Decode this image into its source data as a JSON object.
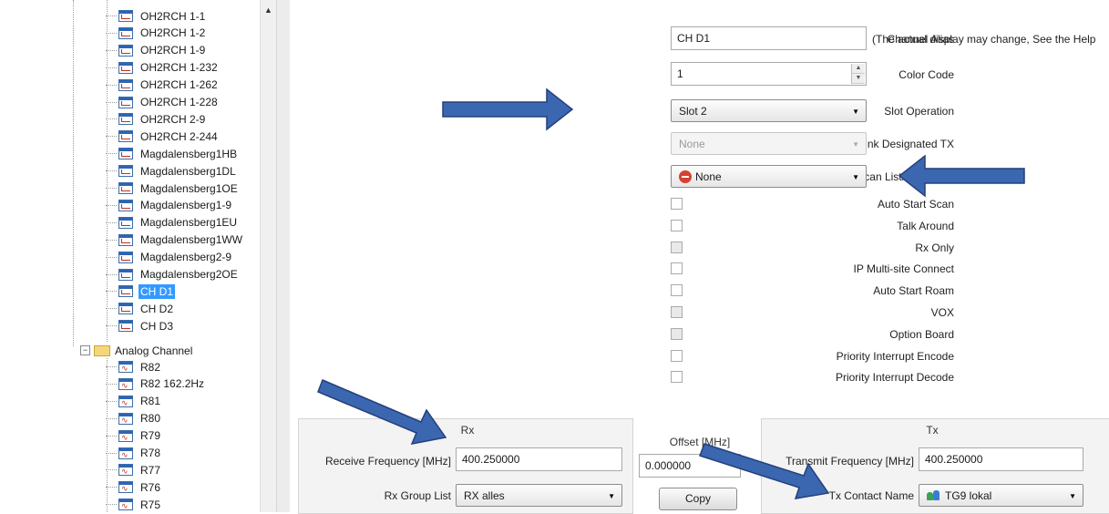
{
  "tree": {
    "digital_channels": [
      "OH2RCH 1-1",
      "OH2RCH 1-2",
      "OH2RCH 1-9",
      "OH2RCH 1-232",
      "OH2RCH 1-262",
      "OH2RCH 1-228",
      "OH2RCH 2-9",
      "OH2RCH 2-244",
      "Magdalensberg1HB",
      "Magdalensberg1DL",
      "Magdalensberg1OE",
      "Magdalensberg1-9",
      "Magdalensberg1EU",
      "Magdalensberg1WW",
      "Magdalensberg2-9",
      "Magdalensberg2OE",
      "CH D1",
      "CH D2",
      "CH D3"
    ],
    "selected": "CH D1",
    "folder_label": "Analog Channel",
    "analog_channels": [
      "R82",
      "R82 162.2Hz",
      "R81",
      "R80",
      "R79",
      "R78",
      "R77",
      "R76",
      "R75"
    ]
  },
  "form": {
    "channel_alias": {
      "label": "Channel Alias",
      "value": "CH D1",
      "note": "(The actual display may change, See the Help"
    },
    "color_code": {
      "label": "Color Code",
      "value": "1"
    },
    "slot_operation": {
      "label": "Slot Operation",
      "value": "Slot 2"
    },
    "pseudo_trunk": {
      "label": "Pseudo Trunk Designated TX",
      "value": "None"
    },
    "scan_list": {
      "label": "Scan List/Roam List",
      "value": "None"
    },
    "checkboxes": [
      {
        "label": "Auto Start Scan",
        "checked": false,
        "gray": false
      },
      {
        "label": "Talk Around",
        "checked": false,
        "gray": false
      },
      {
        "label": "Rx Only",
        "checked": false,
        "gray": true
      },
      {
        "label": "IP Multi-site Connect",
        "checked": false,
        "gray": false
      },
      {
        "label": "Auto Start Roam",
        "checked": false,
        "gray": false
      },
      {
        "label": "VOX",
        "checked": false,
        "gray": true
      },
      {
        "label": "Option Board",
        "checked": false,
        "gray": true
      },
      {
        "label": "Priority Interrupt Encode",
        "checked": false,
        "gray": false
      },
      {
        "label": "Priority Interrupt Decode",
        "checked": false,
        "gray": false
      }
    ],
    "rx": {
      "title": "Rx",
      "freq_label": "Receive Frequency [MHz]",
      "freq_value": "400.250000",
      "group_label": "Rx Group List",
      "group_value": "RX alles"
    },
    "offset": {
      "title": "Offset [MHz]",
      "value": "0.000000",
      "copy_label": "Copy"
    },
    "tx": {
      "title": "Tx",
      "freq_label": "Transmit Frequency [MHz]",
      "freq_value": "400.250000",
      "contact_label": "Tx Contact Name",
      "contact_value": "TG9 lokal"
    }
  },
  "colors": {
    "arrow": "#3a67b0",
    "arrow_border": "#24407a",
    "selection": "#3399ff"
  }
}
